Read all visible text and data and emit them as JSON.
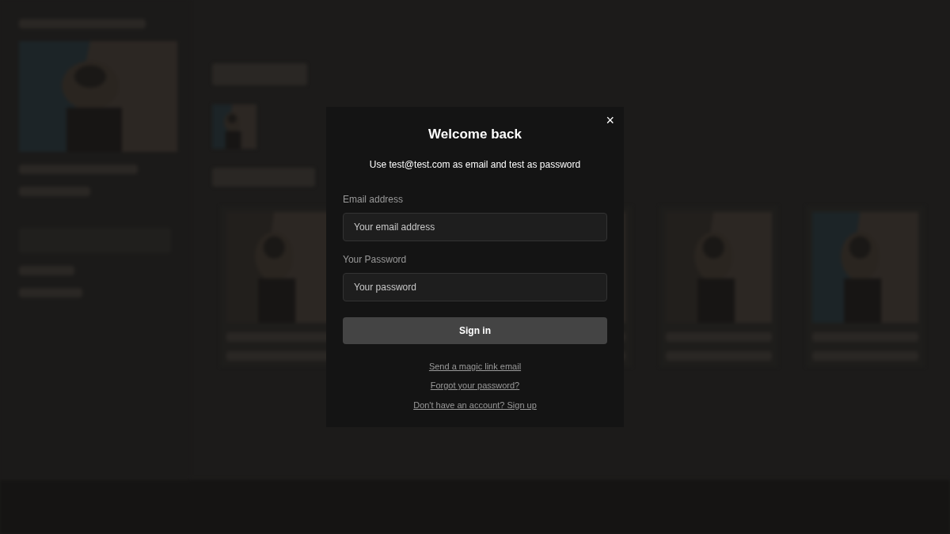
{
  "dialog": {
    "title": "Welcome back",
    "close_icon": "×",
    "hint": "Use test@test.com as email and test as password",
    "fields": [
      {
        "label": "Email address",
        "placeholder": "Your email address"
      },
      {
        "label": "Your Password",
        "placeholder": "Your password"
      }
    ],
    "submit": "Sign in",
    "links": [
      "Send a magic link email",
      "Forgot your password?",
      "Don't have an account? Sign up"
    ]
  }
}
